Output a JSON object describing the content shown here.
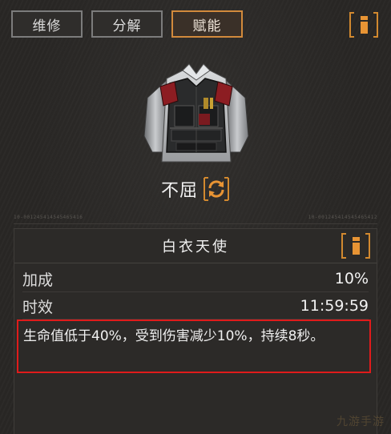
{
  "tabs": [
    {
      "label": "维修",
      "active": false
    },
    {
      "label": "分解",
      "active": false
    },
    {
      "label": "赋能",
      "active": true
    }
  ],
  "item": {
    "name": "不屈",
    "image_icon": "tactical-vest-icon",
    "swap_icon": "refresh-icon",
    "code_left": "10-001245414545465416",
    "code_right": "10-001245414545465412"
  },
  "skill": {
    "name": "白衣天使",
    "info_icon": "info-icon",
    "stats": [
      {
        "label": "加成",
        "value": "10%"
      },
      {
        "label": "时效",
        "value": "11:59:59"
      }
    ],
    "description": "生命值低于40%，受到伤害减少10%，持续8秒。"
  },
  "colors": {
    "accent": "#e89434",
    "highlight_border": "#e01b1b",
    "tab_border": "#7c7c7c",
    "tab_active_border": "#d28a3c"
  },
  "watermark": "九游手游"
}
